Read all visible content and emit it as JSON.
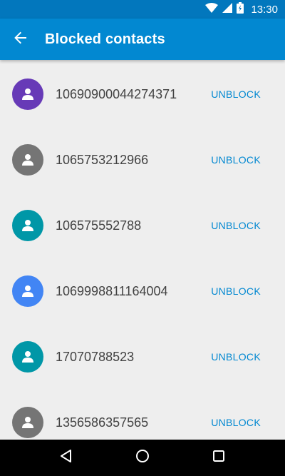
{
  "status_bar": {
    "time": "13:30",
    "icons": [
      "wifi-icon",
      "signal-icon",
      "battery-icon"
    ]
  },
  "app_bar": {
    "title": "Blocked contacts",
    "back_icon": "arrow-back-icon",
    "color": "#0288d1",
    "status_color": "#0277bd"
  },
  "contacts": [
    {
      "number": "10690900044274371",
      "action": "UNBLOCK",
      "avatar_color": "#673ab7"
    },
    {
      "number": "1065753212966",
      "action": "UNBLOCK",
      "avatar_color": "#757575"
    },
    {
      "number": "106575552788",
      "action": "UNBLOCK",
      "avatar_color": "#0097a7"
    },
    {
      "number": "1069998811164004",
      "action": "UNBLOCK",
      "avatar_color": "#4285f4"
    },
    {
      "number": "17070788523",
      "action": "UNBLOCK",
      "avatar_color": "#0097a7"
    },
    {
      "number": "1356586357565",
      "action": "UNBLOCK",
      "avatar_color": "#757575"
    }
  ],
  "nav_bar": {
    "icons": [
      "back-triangle-icon",
      "home-circle-icon",
      "recents-square-icon"
    ]
  }
}
